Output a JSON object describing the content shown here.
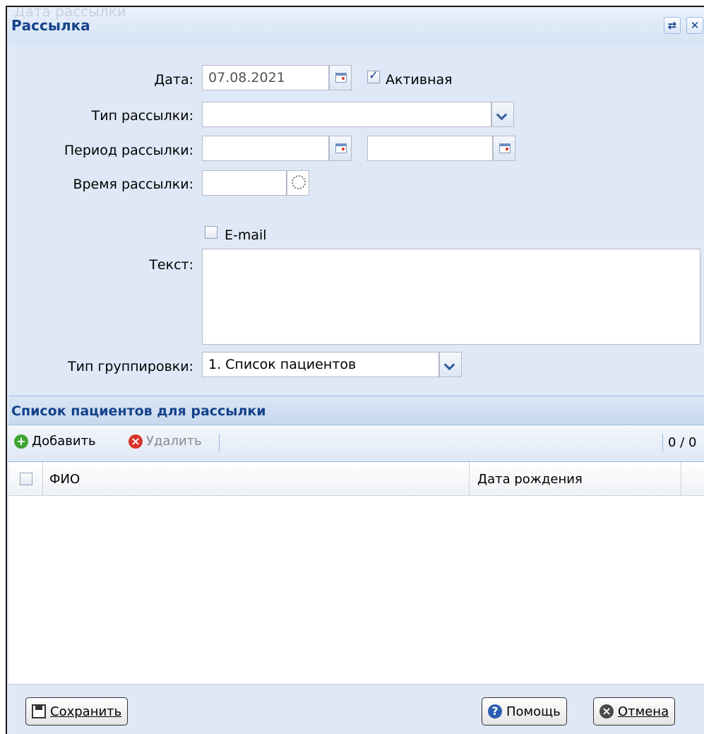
{
  "window": {
    "title": "Рассылка",
    "ghost_text": "Дата рассылки"
  },
  "form": {
    "date_label": "Дата:",
    "date_value": "07.08.2021",
    "active_label": "Активная",
    "active_checked": true,
    "type_label": "Тип рассылки:",
    "type_value": "",
    "period_label": "Период рассылки:",
    "period_from": "",
    "period_to": "",
    "time_label": "Время рассылки:",
    "time_value": "",
    "email_label": "E-mail",
    "email_checked": false,
    "text_label": "Текст:",
    "text_value": "",
    "grouping_label": "Тип группировки:",
    "grouping_value": "1. Список пациентов"
  },
  "patients": {
    "title": "Список пациентов для рассылки",
    "add_label": "Добавить",
    "delete_label": "Удалить",
    "counter": "0 / 0",
    "columns": [
      "ФИО",
      "Дата рождения"
    ]
  },
  "footer": {
    "save_label": "Сохранить",
    "help_label": "Помощь",
    "cancel_label": "Отмена"
  },
  "colors": {
    "title_blue": "#15428b",
    "panel_bg": "#dfe8f6",
    "add_green": "#3fa535",
    "delete_red": "#d9342b",
    "help_blue": "#2a5db0"
  }
}
